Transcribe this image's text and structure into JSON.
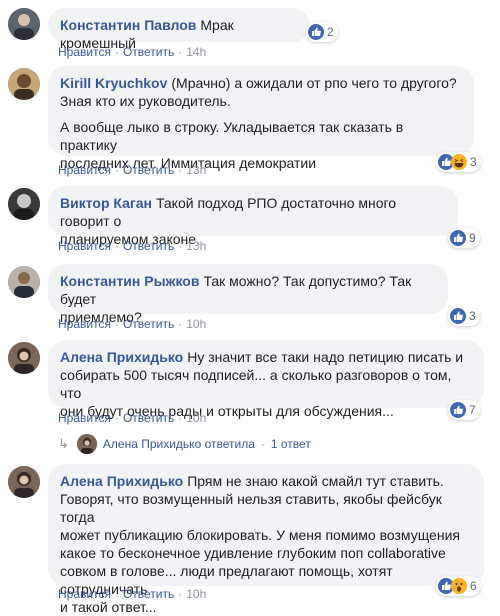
{
  "actions": {
    "like": "Нравится",
    "reply": "Ответить"
  },
  "comments": [
    {
      "author": "Константин Павлов",
      "paragraphs": [
        "Мрак кромешный"
      ],
      "time": "14h",
      "reactions": {
        "types": [
          "like"
        ],
        "count": "2"
      },
      "avatar_color": "#5c6470"
    },
    {
      "author": "Kirill Kryuchkov",
      "paragraphs": [
        "(Мрачно) а ожидали от рпо чего то другого?\nЗная кто их руководитель.",
        "А вообще лыко в строку. Укладывается так сказать в практику\nпоследних лет. Иммитация демократии"
      ],
      "time": "13h",
      "reactions": {
        "types": [
          "like",
          "haha"
        ],
        "count": "3"
      },
      "avatar_color": "#b08a5a"
    },
    {
      "author": "Виктор Каган",
      "paragraphs": [
        "Такой подход РПО достаточно много говорит о\nпланируемом законе."
      ],
      "time": "13h",
      "reactions": {
        "types": [
          "like"
        ],
        "count": "9"
      },
      "avatar_color": "#4a4a4a"
    },
    {
      "author": "Константин Рыжков",
      "paragraphs": [
        "Так можно? Так допустимо? Так будет\nприемлемо?"
      ],
      "time": "10h",
      "reactions": {
        "types": [
          "like"
        ],
        "count": "3"
      },
      "avatar_color": "#6a5a4a"
    },
    {
      "author": "Алена Прихидько",
      "paragraphs": [
        "Ну значит все таки надо петицию писать и\nсобирать 500 тысяч подписей... а сколько разговоров о том, что\nони будут очень рады и открыты для обсуждения..."
      ],
      "time": "10h",
      "reactions": {
        "types": [
          "like"
        ],
        "count": "7"
      },
      "avatar_color": "#7a6658"
    },
    {
      "author": "Алена Прихидько",
      "paragraphs": [
        "Прям не знаю какой смайл тут ставить.\nГоворят, что возмущенный нельзя ставить, якобы фейсбук тогда\nможет публикацию блокировать. У меня помимо возмущения\nкакое то бесконечное удивление глубоким поп collaborative\nсовком в голове... люди предлагают помощь, хотят сотрудничать\nи такой ответ..."
      ],
      "time": "10h",
      "reactions": {
        "types": [
          "like",
          "wow"
        ],
        "count": "6"
      },
      "avatar_color": "#7a6658"
    }
  ],
  "reply_summary": {
    "author": "Алена Прихидько",
    "verb": "ответила",
    "count": "1 ответ"
  },
  "colors": {
    "link": "#385898",
    "bubble": "#f2f3f5",
    "like_blue": "#4267b2",
    "haha_yellow": "#f7b125"
  }
}
